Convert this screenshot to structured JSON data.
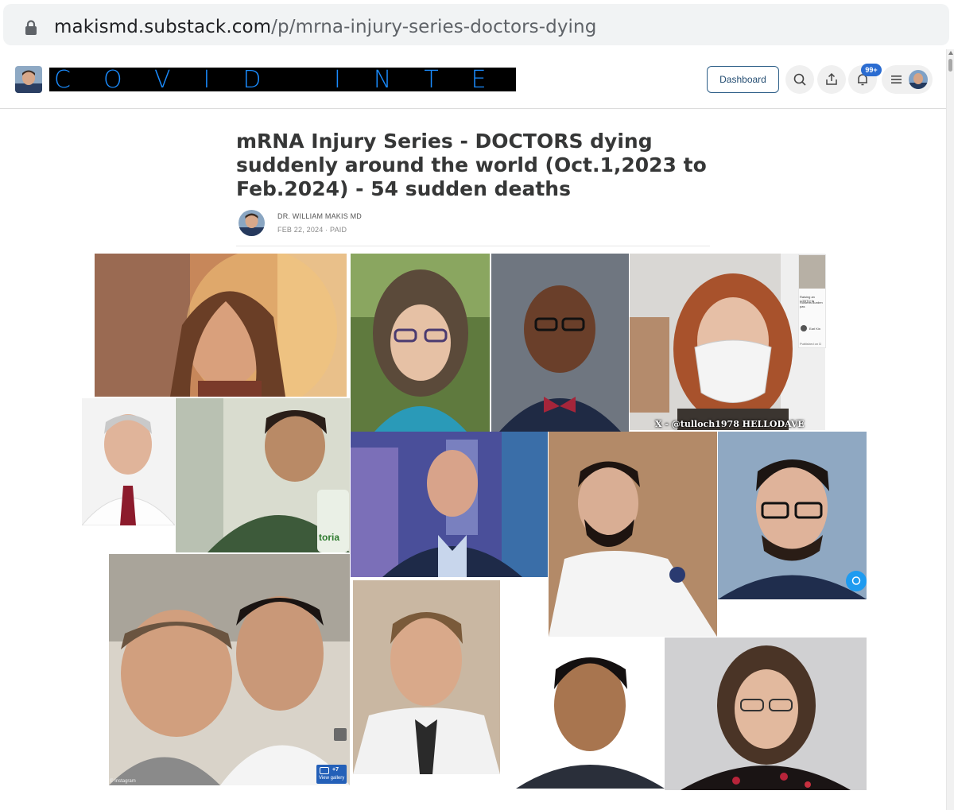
{
  "browser": {
    "url_host": "makismd.substack.com",
    "url_path": "/p/mrna-injury-series-doctors-dying"
  },
  "header": {
    "publication_logo_text": "COVID INTEL",
    "dashboard_label": "Dashboard",
    "notification_badge": "99+"
  },
  "article": {
    "title": "mRNA Injury Series - DOCTORS dying suddenly around the world (Oct.1,2023 to Feb.2024) - 54 sudden deaths",
    "author": "DR. WILLIAM MAKIS MD",
    "date_line": "FEB 22, 2024 · PAID"
  },
  "collage": {
    "x_caption": "X - @tulloch1978 HELLODAVE",
    "gallery_count": "+7",
    "gallery_label": "View gallery",
    "instagram_credit": "© Instagram",
    "snippet_line1": "Raising an LGBTQ fa",
    "snippet_line2": "Rowena Burden pas",
    "snippet_name": "Earl Kin",
    "snippet_published": "Published on D",
    "shirt_text": "toria"
  },
  "colors": {
    "title": "#363737",
    "dashboard_border": "#2d5f88",
    "logo_text": "#1a8cff",
    "badge": "#2b6cd1"
  }
}
